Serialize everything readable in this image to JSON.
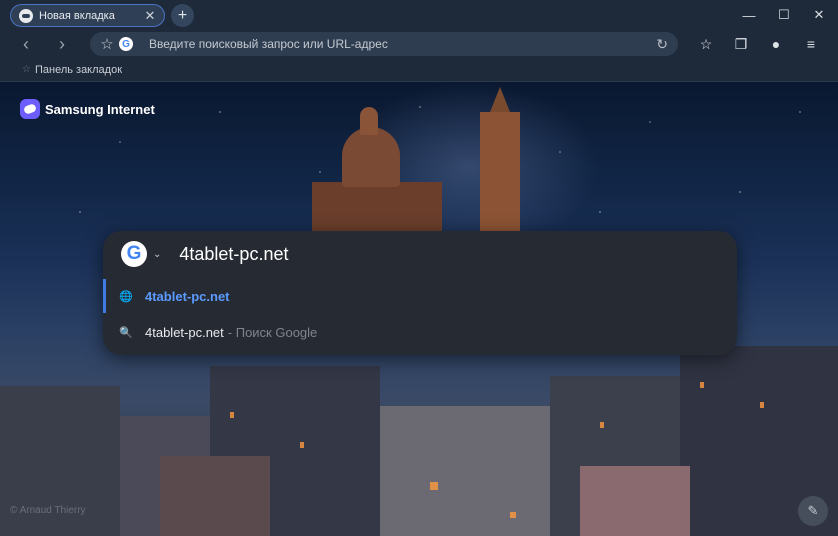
{
  "tabs": [
    {
      "label": "Новая вкладка",
      "close": "✕"
    }
  ],
  "new_tab": "+",
  "window_controls": {
    "minimize": "—",
    "maximize": "☐",
    "close": "✕"
  },
  "nav": {
    "back": "‹",
    "forward": "›"
  },
  "omnibox": {
    "star": "☆",
    "engine_icon": "G",
    "placeholder": "Введите поисковый запрос или URL-адрес",
    "reload": "↻"
  },
  "toolbar_icons": {
    "bookmarks": "☆",
    "tabs": "❐",
    "profile": "●",
    "menu": "≡"
  },
  "bookmarks_bar": {
    "icon": "☆",
    "label": "Панель закладок"
  },
  "new_tab_page": {
    "brand": "Samsung Internet"
  },
  "search": {
    "engine_icon": "G",
    "engine_caret": "⌄",
    "query": "4tablet-pc.net",
    "suggestions": [
      {
        "icon": "🌐",
        "text": "4tablet-pc.net",
        "suffix": ""
      },
      {
        "icon": "🔍",
        "text": "4tablet-pc.net",
        "suffix": "- Поиск Google"
      }
    ]
  },
  "credit": "© Arnaud Thierry",
  "edit_button": "✎",
  "colors": {
    "accent": "#4a73c4",
    "link": "#5b9bff",
    "chrome": "#1e2a3a"
  }
}
